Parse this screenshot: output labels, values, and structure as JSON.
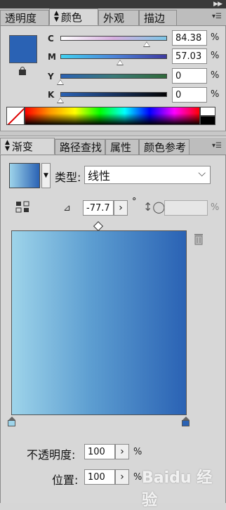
{
  "color_panel": {
    "tabs": [
      {
        "label": "透明度"
      },
      {
        "label": "颜色"
      },
      {
        "label": "外观"
      },
      {
        "label": "描边"
      }
    ],
    "active_tab": "颜色",
    "fill_color": "#2a62b4",
    "sliders": [
      {
        "label": "C",
        "value": "84.38",
        "unit": "%",
        "level": 0.8438
      },
      {
        "label": "M",
        "value": "57.03",
        "unit": "%",
        "level": 0.5703
      },
      {
        "label": "Y",
        "value": "0",
        "unit": "%",
        "level": 0
      },
      {
        "label": "K",
        "value": "0",
        "unit": "%",
        "level": 0
      }
    ]
  },
  "gradient_panel": {
    "tabs": [
      {
        "label": "渐变"
      },
      {
        "label": "路径查找"
      },
      {
        "label": "属性"
      },
      {
        "label": "颜色参考"
      }
    ],
    "active_tab": "渐变",
    "type_label": "类型:",
    "type_value": "线性",
    "angle_value": "-77.7",
    "angle_unit": "°",
    "aspect_value": "%",
    "gradient": {
      "start_color": "#9ed4ea",
      "end_color": "#2a62b4"
    },
    "opacity_label": "不透明度:",
    "opacity_value": "100",
    "opacity_unit": "%",
    "location_label": "位置:",
    "location_value": "100",
    "location_unit": "%"
  },
  "watermark": "Baidu 经验"
}
